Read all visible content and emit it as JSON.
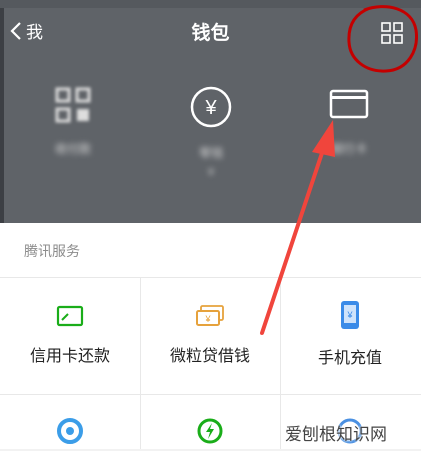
{
  "nav": {
    "back_label": "我",
    "title": "钱包"
  },
  "wallet": {
    "items": [
      {
        "icon": "qr-pay-icon",
        "label": "收付款",
        "sub": ""
      },
      {
        "icon": "yuan-coin-icon",
        "label": "零钱",
        "sub": "¥"
      },
      {
        "icon": "bank-card-icon",
        "label": "银行卡",
        "sub": ""
      }
    ]
  },
  "services": {
    "section_title": "腾讯服务",
    "items": [
      {
        "label": "信用卡还款",
        "icon": "credit-card-icon",
        "color": "#1aad19"
      },
      {
        "label": "微粒贷借钱",
        "icon": "cash-loan-icon",
        "color": "#e6a23c"
      },
      {
        "label": "手机充值",
        "icon": "phone-topup-icon",
        "color": "#3b8be8"
      }
    ]
  },
  "annotation_color": "#c40000",
  "arrow_color": "#f0453c",
  "watermark": "爱刨根知识网"
}
